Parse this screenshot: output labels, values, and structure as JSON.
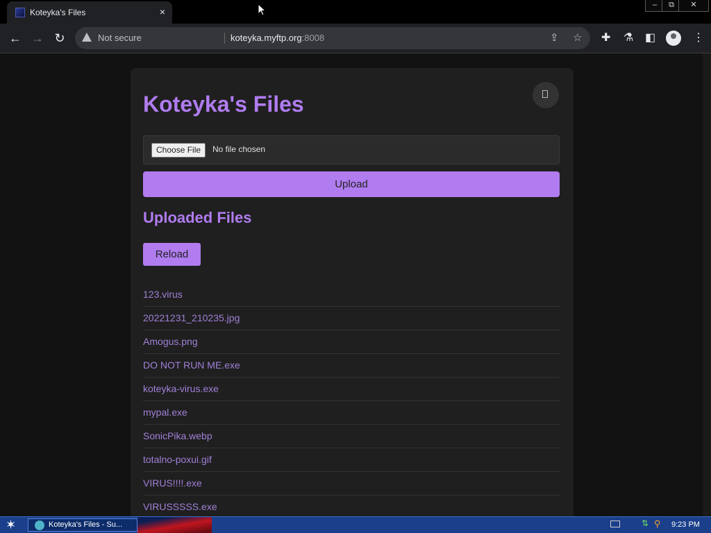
{
  "browser": {
    "tab_title": "Koteyka's Files",
    "tab_close": "×",
    "window_minimize": "–",
    "window_restore": "⧉",
    "window_close": "✕",
    "back": "←",
    "forward": "→",
    "refresh": "↻",
    "security_label": "Not secure",
    "url_host": "koteyka.myftp.org",
    "url_port": ":8008",
    "share_icon": "⇪",
    "star_icon": "☆",
    "extensions_icon": "✚",
    "labs_icon": "⚗",
    "sidepanel_icon": "◧",
    "menu_icon": "⋮"
  },
  "page": {
    "title": "Koteyka's Files",
    "choose_file_label": "Choose File",
    "no_file_label": "No file chosen",
    "upload_label": "Upload",
    "section_title": "Uploaded Files",
    "reload_label": "Reload",
    "files": [
      "123.virus",
      "20221231_210235.jpg",
      "Amogus.png",
      "DO NOT RUN ME.exe",
      "koteyka-virus.exe",
      "mypal.exe",
      "SonicPika.webp",
      "totalno-poxui.gif",
      "VIRUS!!!!.exe",
      "VIRUSSSSS.exe"
    ]
  },
  "taskbar": {
    "start_icon": "✶",
    "task_label": "Koteyka's Files - Su...",
    "clock": "9:23 PM"
  },
  "colors": {
    "accent": "#b07cf0",
    "background": "#121212",
    "card": "#1f1f1f"
  }
}
